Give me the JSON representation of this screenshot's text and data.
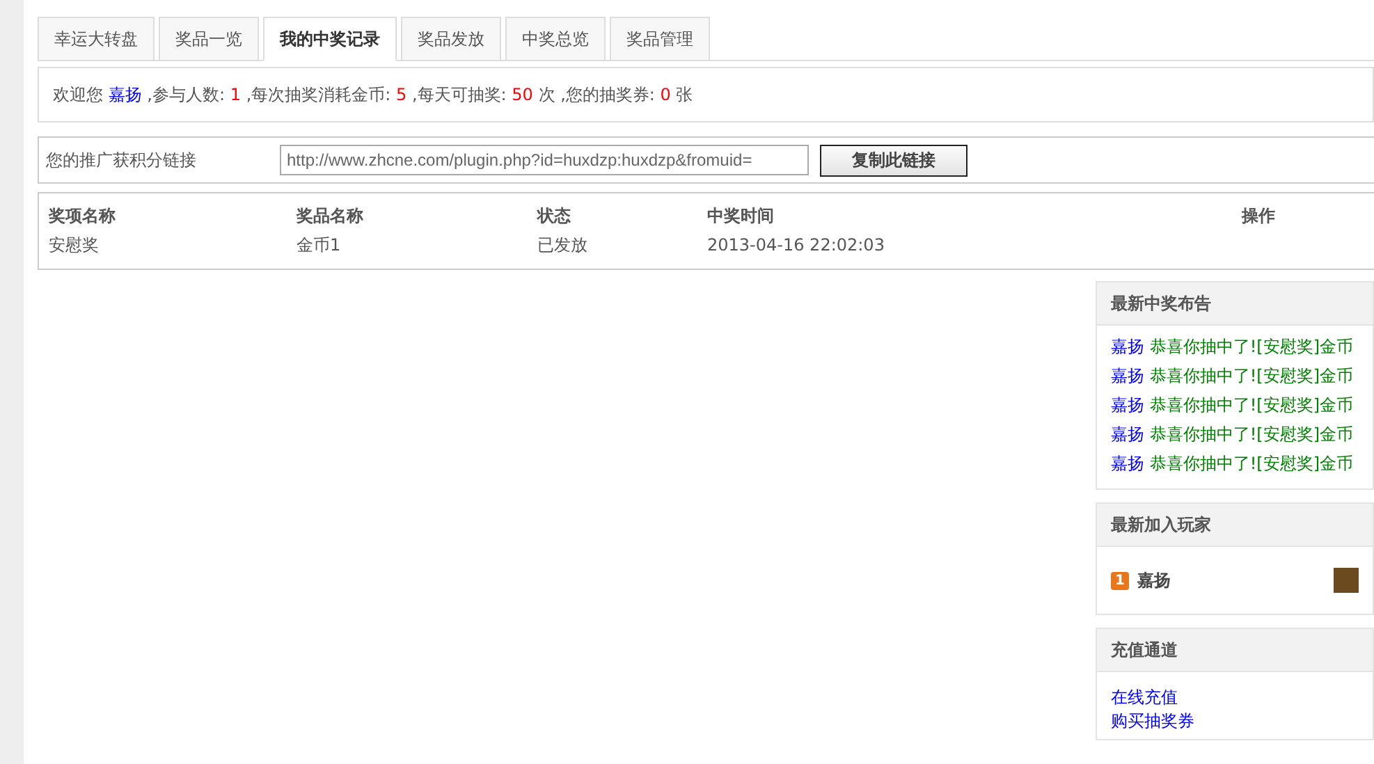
{
  "tabs": [
    {
      "label": "幸运大转盘",
      "selected": false
    },
    {
      "label": "奖品一览",
      "selected": false
    },
    {
      "label": "我的中奖记录",
      "selected": true
    },
    {
      "label": "奖品发放",
      "selected": false
    },
    {
      "label": "中奖总览",
      "selected": false
    },
    {
      "label": "奖品管理",
      "selected": false
    }
  ],
  "welcome": {
    "greeting": "欢迎您",
    "user": "嘉扬",
    "stats": [
      {
        "label": ",参与人数:",
        "value": "1"
      },
      {
        "label": ",每次抽奖消耗金币:",
        "value": "5"
      },
      {
        "label": ",每天可抽奖:",
        "value": "50",
        "unit": "次"
      },
      {
        "label": ",您的抽奖券:",
        "value": "0",
        "unit": "张"
      }
    ]
  },
  "promo": {
    "label": "您的推广获积分链接",
    "url": "http://www.zhcne.com/plugin.php?id=huxdzp:huxdzp&fromuid=",
    "button": "复制此链接"
  },
  "table": {
    "columns": [
      "奖项名称",
      "奖品名称",
      "状态",
      "中奖时间",
      "操作"
    ],
    "rows": [
      [
        "安慰奖",
        "金币1",
        "已发放",
        "2013-04-16 22:02:03",
        ""
      ]
    ]
  },
  "announcements": {
    "title": "最新中奖布告",
    "items": [
      {
        "user": "嘉扬",
        "message": "恭喜你抽中了![安慰奖]金币"
      },
      {
        "user": "嘉扬",
        "message": "恭喜你抽中了![安慰奖]金币"
      },
      {
        "user": "嘉扬",
        "message": "恭喜你抽中了![安慰奖]金币"
      },
      {
        "user": "嘉扬",
        "message": "恭喜你抽中了![安慰奖]金币"
      },
      {
        "user": "嘉扬",
        "message": "恭喜你抽中了![安慰奖]金币"
      }
    ]
  },
  "new_players": {
    "title": "最新加入玩家",
    "items": [
      {
        "rank": "1",
        "name": "嘉扬"
      }
    ]
  },
  "recharge": {
    "title": "充值通道",
    "links": [
      "在线充值",
      "购买抽奖券"
    ]
  }
}
